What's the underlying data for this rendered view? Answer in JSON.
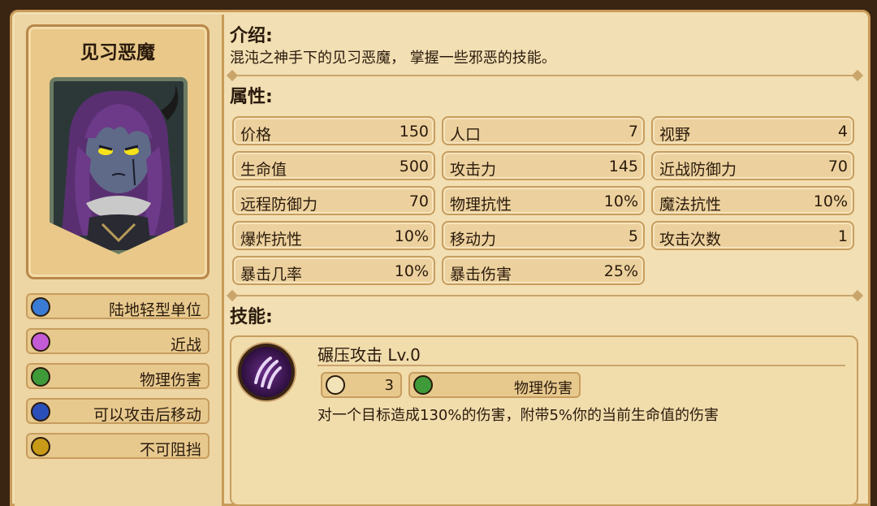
{
  "unit": {
    "name": "见习恶魔",
    "portrait_icon": "purple-haired-demon-portrait"
  },
  "tags": [
    {
      "label": "陆地轻型单位",
      "icon": "unit-type-icon",
      "color": "#3a7bd5"
    },
    {
      "label": "近战",
      "icon": "melee-target-icon",
      "color": "#c35ad6"
    },
    {
      "label": "物理伤害",
      "icon": "sword-icon",
      "color": "#3f9b3a"
    },
    {
      "label": "可以攻击后移动",
      "icon": "move-after-attack-icon",
      "color": "#2a4fb8"
    },
    {
      "label": "不可阻挡",
      "icon": "unstoppable-icon",
      "color": "#c79a17"
    }
  ],
  "intro": {
    "title": "介绍:",
    "text": "混沌之神手下的见习恶魔， 掌握一些邪恶的技能。"
  },
  "attributes": {
    "title": "属性:",
    "stats": [
      {
        "label": "价格",
        "value": "150"
      },
      {
        "label": "人口",
        "value": "7"
      },
      {
        "label": "视野",
        "value": "4"
      },
      {
        "label": "生命值",
        "value": "500"
      },
      {
        "label": "攻击力",
        "value": "145"
      },
      {
        "label": "近战防御力",
        "value": "70"
      },
      {
        "label": "远程防御力",
        "value": "70"
      },
      {
        "label": "物理抗性",
        "value": "10%"
      },
      {
        "label": "魔法抗性",
        "value": "10%"
      },
      {
        "label": "爆炸抗性",
        "value": "10%"
      },
      {
        "label": "移动力",
        "value": "5"
      },
      {
        "label": "攻击次数",
        "value": "1"
      },
      {
        "label": "暴击几率",
        "value": "10%"
      },
      {
        "label": "暴击伤害",
        "value": "25%"
      }
    ]
  },
  "skills": {
    "title": "技能:",
    "items": [
      {
        "name": "碾压攻击 Lv.0",
        "icon": "claw-slash-icon",
        "cooldown": "3",
        "damage_type": "物理伤害",
        "description": "对一个目标造成130%的伤害，附带5%你的当前生命值的伤害"
      }
    ]
  }
}
